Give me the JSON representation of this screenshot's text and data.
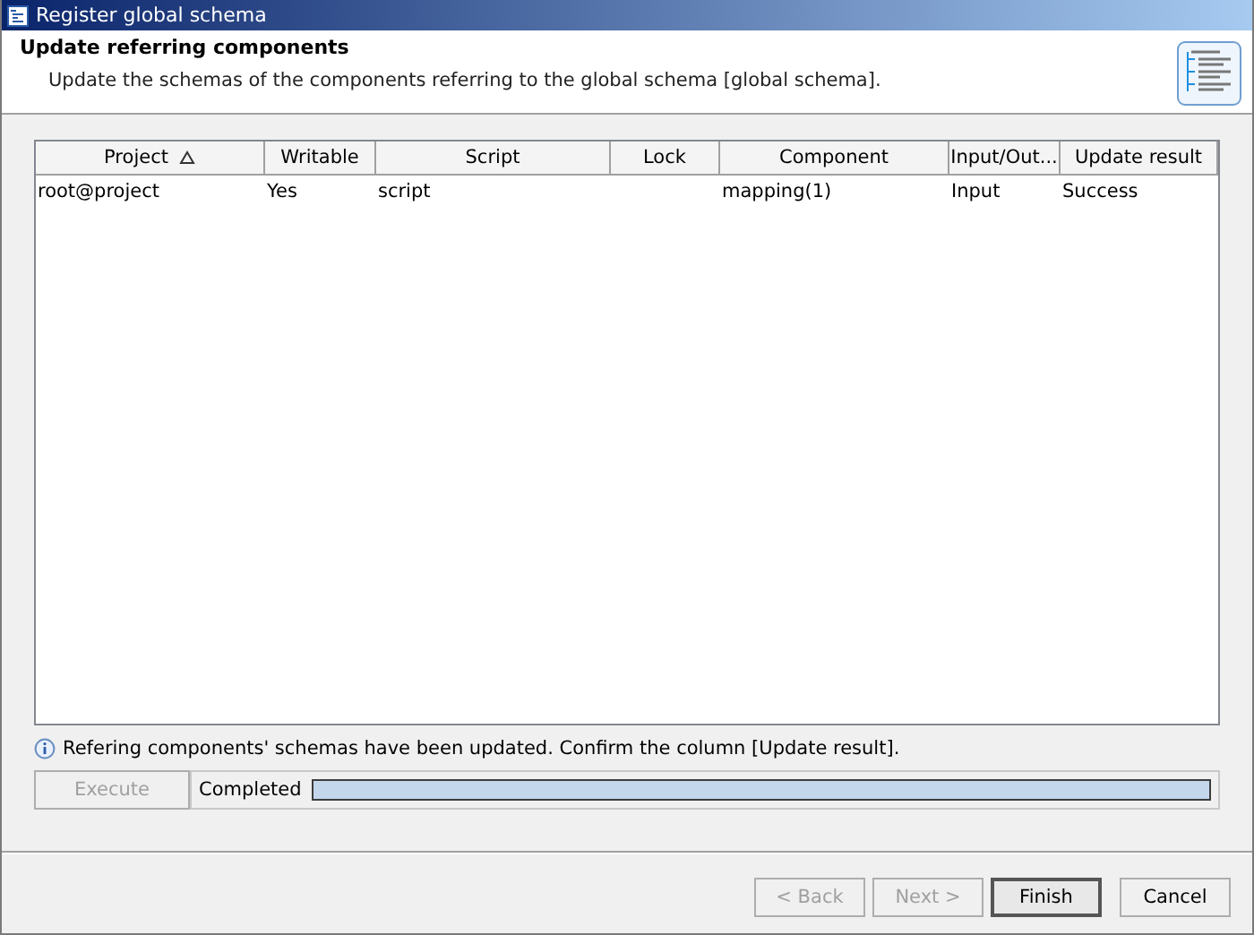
{
  "window": {
    "title": "Register global schema"
  },
  "header": {
    "title": "Update referring components",
    "description": "Update the schemas of the components referring to the global schema [global schema]."
  },
  "table": {
    "columns": [
      {
        "label": "Project",
        "sorted": true
      },
      {
        "label": "Writable",
        "sorted": false
      },
      {
        "label": "Script",
        "sorted": false
      },
      {
        "label": "Lock",
        "sorted": false
      },
      {
        "label": "Component",
        "sorted": false
      },
      {
        "label": "Input/Out...",
        "sorted": false
      },
      {
        "label": "Update result",
        "sorted": false
      }
    ],
    "rows": [
      [
        "root@project",
        "Yes",
        "script",
        "",
        "mapping(1)",
        "Input",
        "Success"
      ]
    ]
  },
  "info_message": "Refering components' schemas have been updated. Confirm the column [Update result].",
  "execute_button": {
    "label": "Execute",
    "disabled": true
  },
  "progress": {
    "status": "Completed",
    "level": 1
  },
  "buttons": [
    {
      "label": "< Back",
      "disabled": true,
      "default": false
    },
    {
      "label": "Next >",
      "disabled": true,
      "default": false
    },
    {
      "label": "Finish",
      "disabled": false,
      "default": true
    },
    {
      "label": "Cancel",
      "disabled": false,
      "default": false
    }
  ]
}
